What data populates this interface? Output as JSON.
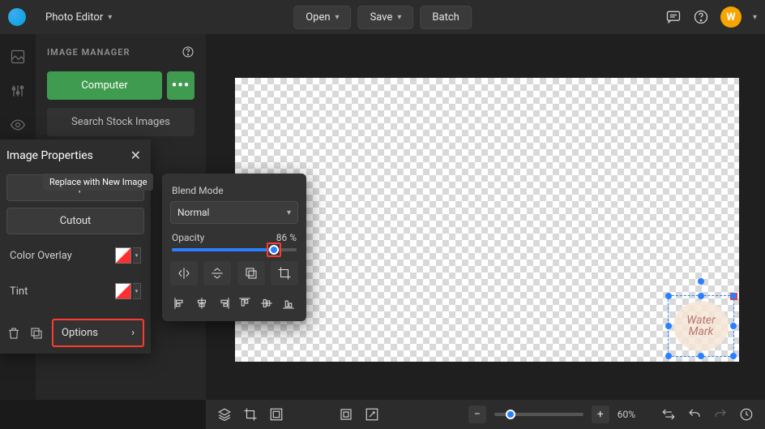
{
  "header": {
    "app_title": "Photo Editor",
    "open_label": "Open",
    "save_label": "Save",
    "batch_label": "Batch",
    "avatar_initial": "W"
  },
  "image_manager": {
    "title": "IMAGE MANAGER",
    "computer_label": "Computer",
    "search_label": "Search Stock Images"
  },
  "image_properties": {
    "title": "Image Properties",
    "replace_label": "Rep",
    "replace_tooltip": "Replace with New Image",
    "cutout_label": "Cutout",
    "color_overlay_label": "Color Overlay",
    "tint_label": "Tint",
    "options_label": "Options"
  },
  "options_popover": {
    "blend_mode_label": "Blend Mode",
    "blend_mode_value": "Normal",
    "opacity_label": "Opacity",
    "opacity_value": "86 %"
  },
  "watermark": {
    "line1": "Water",
    "line2": "Mark"
  },
  "bottombar": {
    "zoom_label": "60%"
  }
}
